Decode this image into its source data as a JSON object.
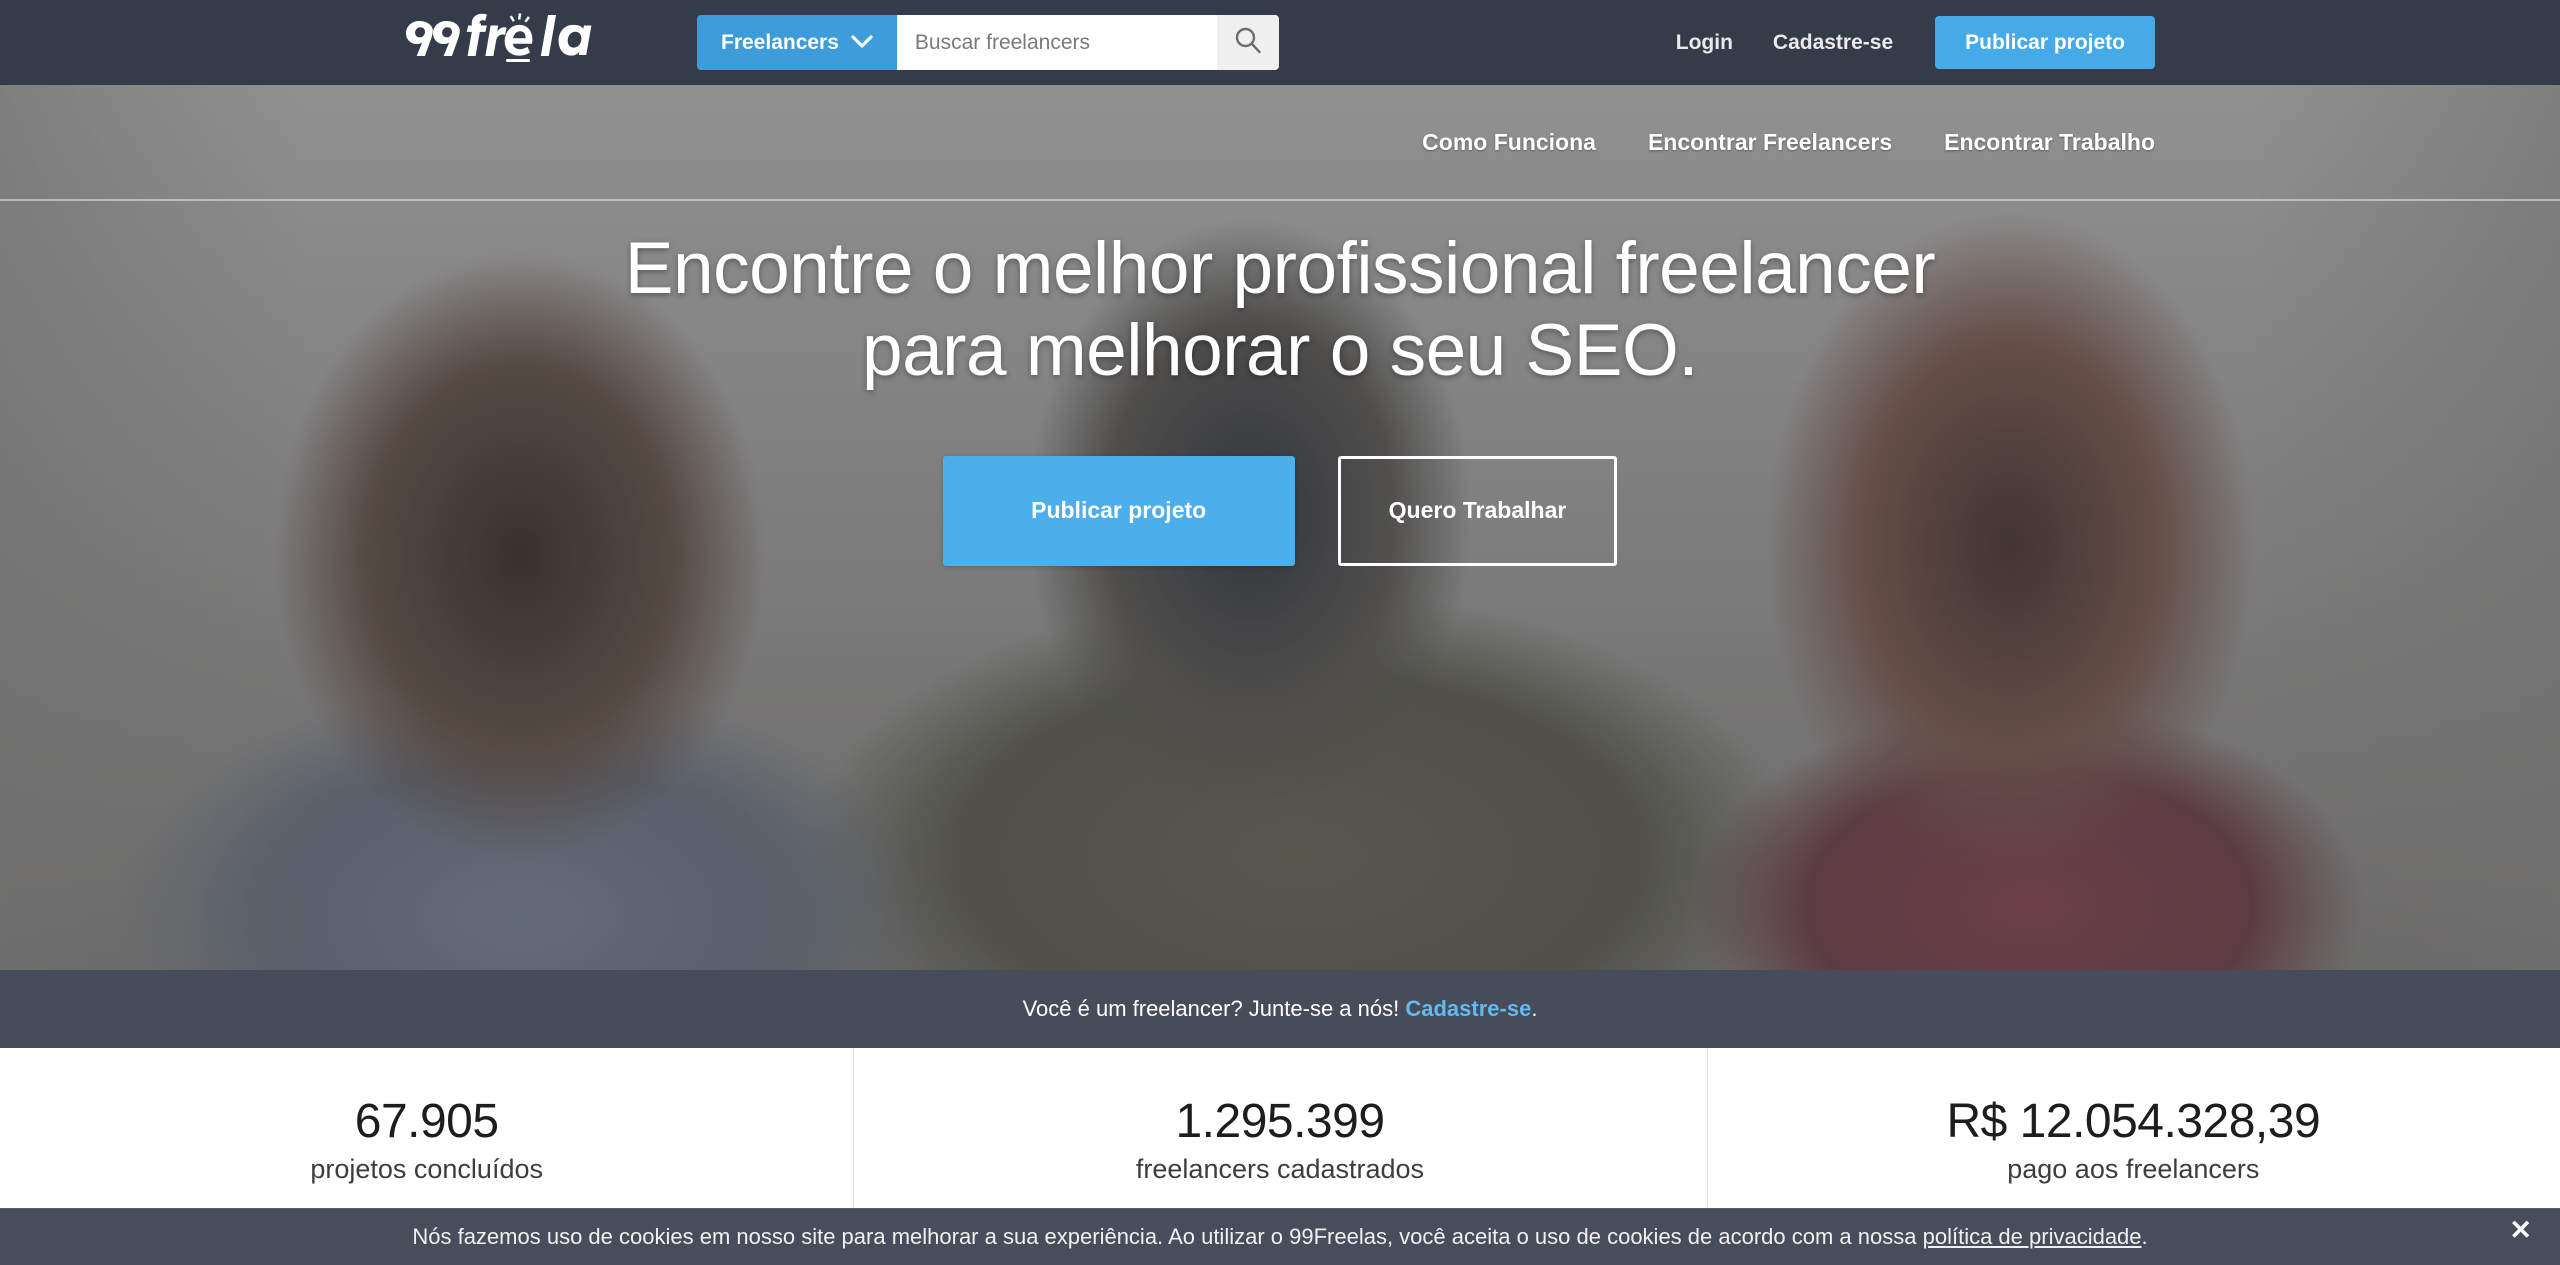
{
  "brand": {
    "name": "99freelas",
    "accent_blue": "#47aae8",
    "header_bg": "#343b49",
    "strip_bg": "#464c59",
    "cookie_bg": "#474d5a"
  },
  "header": {
    "logo_text": "99freelas",
    "logo_icon": "99freelas-logo",
    "category_button": {
      "label": "Freelancers",
      "icon": "chevron-down-icon"
    },
    "search": {
      "placeholder": "Buscar freelancers",
      "value": "",
      "icon": "search-icon"
    },
    "login_label": "Login",
    "register_label": "Cadastre-se",
    "publish_label": "Publicar projeto"
  },
  "subnav": {
    "items": [
      {
        "label": "Como Funciona"
      },
      {
        "label": "Encontrar Freelancers"
      },
      {
        "label": "Encontrar Trabalho"
      }
    ]
  },
  "hero": {
    "title_line1": "Encontre o melhor profissional freelancer",
    "title_line2": "para melhorar o seu SEO.",
    "primary_cta": "Publicar projeto",
    "secondary_cta": "Quero Trabalhar"
  },
  "join_strip": {
    "text": "Você é um freelancer? Junte-se a nós!",
    "link_label": "Cadastre-se",
    "suffix": "."
  },
  "stats": [
    {
      "value": "67.905",
      "label": "projetos concluídos"
    },
    {
      "value": "1.295.399",
      "label": "freelancers cadastrados"
    },
    {
      "value": "R$ 12.054.328,39",
      "label": "pago aos freelancers"
    }
  ],
  "cookie_banner": {
    "text_before": "Nós fazemos uso de cookies em nosso site para melhorar a sua experiência. Ao utilizar o 99Freelas, você aceita o uso de cookies de acordo com a nossa ",
    "link_label": "política de privacidade",
    "text_after": ".",
    "close_icon": "close-icon",
    "close_label": "✕"
  }
}
